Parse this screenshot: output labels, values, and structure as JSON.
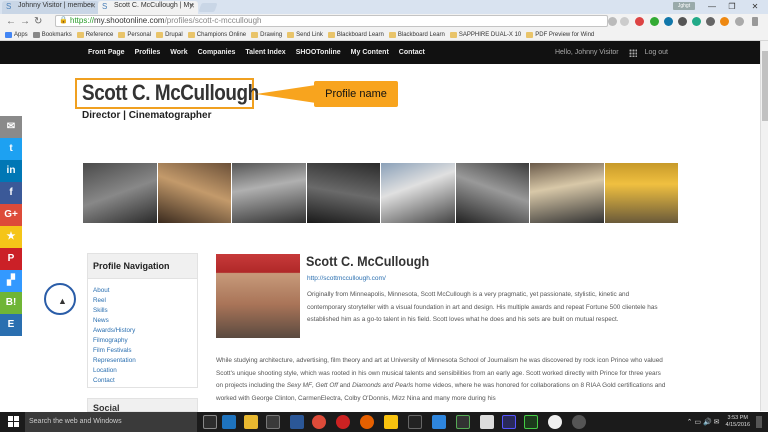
{
  "browser": {
    "tabs": [
      {
        "title": "Johnny Visitor | member"
      },
      {
        "title": "Scott C. McCullough | My"
      }
    ],
    "user_badge": "Jghgt",
    "address": {
      "scheme": "https://",
      "host": "my.shootonline.com",
      "path": "/profiles/scott-c-mccullough"
    },
    "bookmarks": [
      "Apps",
      "Bookmarks",
      "Reference",
      "Personal",
      "Drupal",
      "Champions Online",
      "Drawing",
      "Send Link",
      "Blackboard Learn",
      "Blackboard Learn",
      "SAPPHIRE DUAL-X 10",
      "PDF Preview for Wind"
    ]
  },
  "site": {
    "menu": [
      "Front Page",
      "Profiles",
      "Work",
      "Companies",
      "Talent Index",
      "SHOOTonline",
      "My Content",
      "Contact"
    ],
    "greeting": "Hello, Johnny Visitor",
    "logout": "Log out"
  },
  "profile": {
    "name": "Scott C. McCullough",
    "role": "Director | Cinematographer",
    "callout": "Profile name",
    "heading": "Scott C. McCullough",
    "url": "http://scottmccullough.com/",
    "bio1": "Originally from Minneapolis, Minnesota, Scott McCullough is a very pragmatic, yet passionate, stylistic, kinetic and contemporary storyteller with a visual foundation in art and design. His multiple awards and repeat Fortune 500 clientele has established him as a go-to talent in his field. Scott loves what he does and his sets are built on mutual respect.",
    "bio2_a": "While studying architecture, advertising, film theory and art at University of Minnesota School of Journalism he was discovered by rock icon Prince who valued Scott's unique shooting style, which was rooted in his own musical talents and sensibilities from an early age. Scott worked directly with Prince for three years on projects including the ",
    "bio2_i1": "Sexy MF",
    "bio2_b": ", ",
    "bio2_i2": "Gett Off",
    "bio2_c": " and ",
    "bio2_i3": "Diamonds and Pearls",
    "bio2_d": " home videos, where he was honored for collaborations on 8 RIAA Gold certifications and worked with George Clinton, CarmenElectra, Colby O'Donnis, Mizz Nina and many more during his"
  },
  "profile_nav": {
    "title": "Profile Navigation",
    "items": [
      "About",
      "Reel",
      "Skills",
      "News",
      "Awards/History",
      "Filmography",
      "Film Festivals",
      "Representation",
      "Location",
      "Contact"
    ]
  },
  "social_box_title": "Social",
  "social_share": [
    {
      "icon": "mail-icon",
      "glyph": "✉",
      "color": "#8a8a8a"
    },
    {
      "icon": "twitter-icon",
      "glyph": "t",
      "color": "#1da1f2"
    },
    {
      "icon": "linkedin-icon",
      "glyph": "in",
      "color": "#0077b5"
    },
    {
      "icon": "facebook-icon",
      "glyph": "f",
      "color": "#3b5998"
    },
    {
      "icon": "google-plus-icon",
      "glyph": "G+",
      "color": "#dd4b39"
    },
    {
      "icon": "star-icon",
      "glyph": "★",
      "color": "#f5c518"
    },
    {
      "icon": "pinterest-icon",
      "glyph": "P",
      "color": "#cb2027"
    },
    {
      "icon": "delicious-icon",
      "glyph": "▞",
      "color": "#3399ff"
    },
    {
      "icon": "hatena-icon",
      "glyph": "B!",
      "color": "#6fb536"
    },
    {
      "icon": "evernote-icon",
      "glyph": "E",
      "color": "#2a6fb0"
    }
  ],
  "taskbar": {
    "search_placeholder": "Search the web and Windows",
    "time": "3:53 PM",
    "date": "4/15/2016"
  },
  "colors": {
    "accent": "#f8a41e",
    "link": "#2a6fb0",
    "header_bg": "#111111"
  }
}
